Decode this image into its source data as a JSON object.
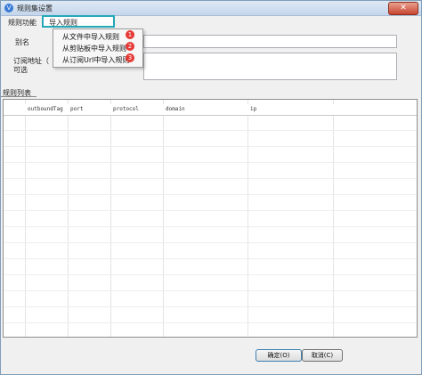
{
  "window": {
    "title": "规则集设置",
    "close_symbol": "✕"
  },
  "menu": {
    "rules_func": "规则功能",
    "import_rules": "导入规则"
  },
  "dropdown": {
    "items": [
      {
        "label": "从文件中导入规则",
        "badge": "1"
      },
      {
        "label": "从剪贴板中导入规则",
        "badge": "2"
      },
      {
        "label": "从订阅Url中导入规则",
        "badge": "3"
      }
    ]
  },
  "form": {
    "alias_label": "别名",
    "sub_url_label_line1": "订阅地址（",
    "sub_url_label_line2": "可选"
  },
  "list": {
    "section_label": "规则列表",
    "columns": [
      "outboundTag",
      "port",
      "protocol",
      "domain",
      "ip"
    ]
  },
  "buttons": {
    "ok": "确定(O)",
    "cancel": "取消(C)"
  },
  "colors": {
    "highlight_border": "#24a8b8",
    "badge": "#e53935"
  }
}
